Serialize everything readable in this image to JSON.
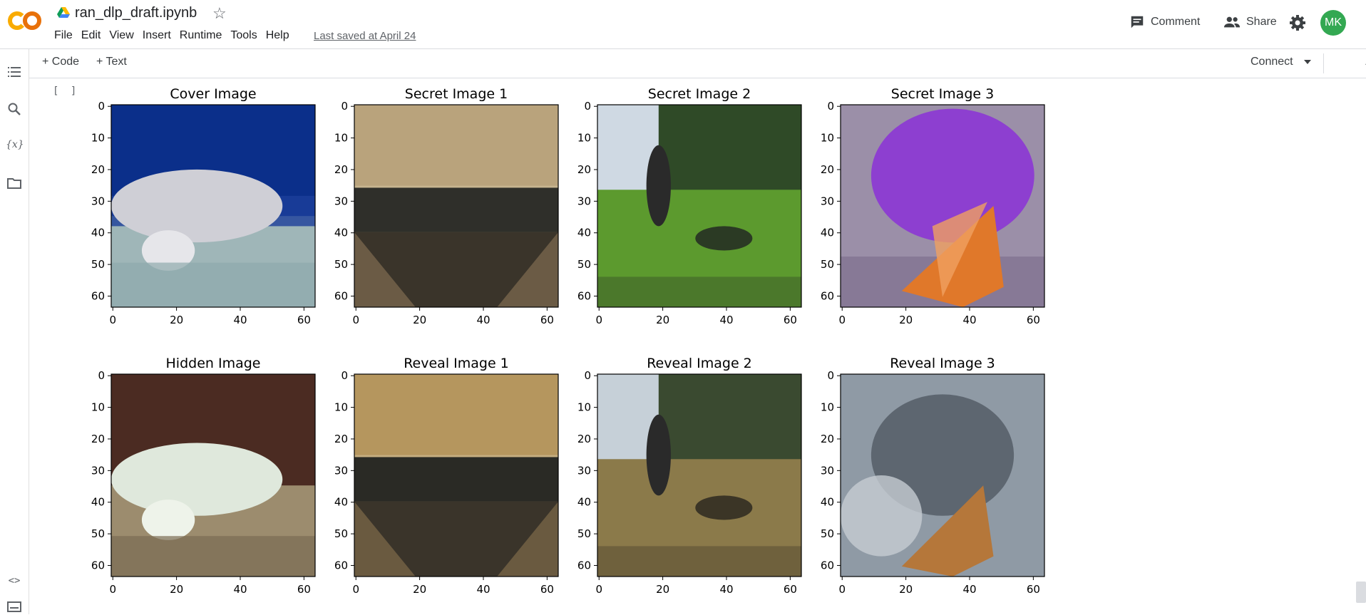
{
  "app": {
    "filename": "ran_dlp_draft.ipynb",
    "logo_text": "CO",
    "menu": [
      "File",
      "Edit",
      "View",
      "Insert",
      "Runtime",
      "Tools",
      "Help"
    ],
    "last_saved": "Last saved at April 24"
  },
  "header": {
    "comment_label": "Comment",
    "share_label": "Share",
    "avatar_initials": "MK",
    "avatar_color": "#33a852"
  },
  "toolbar": {
    "code_label": "+ Code",
    "text_label": "+ Text",
    "connect_label": "Connect"
  },
  "rail_icons": [
    "table-of-contents-icon",
    "search-icon",
    "variables-icon",
    "files-icon",
    "code-snippets-icon",
    "terminal-icon"
  ],
  "cell": {
    "bracket": "[ ]"
  },
  "chart_data": [
    {
      "type": "image",
      "title": "Cover Image",
      "xticks": [
        "0",
        "20",
        "40",
        "60"
      ],
      "yticks": [
        "0",
        "10",
        "20",
        "30",
        "40",
        "50",
        "60"
      ],
      "colors": {
        "top": "#0b2f8a",
        "mid": "#1b3e9a",
        "subject": "#cfcfd6",
        "floor": "#9fb6b8"
      }
    },
    {
      "type": "image",
      "title": "Secret Image 1",
      "xticks": [
        "0",
        "20",
        "40",
        "60"
      ],
      "yticks": [
        "0",
        "10",
        "20",
        "30",
        "40",
        "50",
        "60"
      ],
      "colors": {
        "top": "#b9a37c",
        "band": "#2f2f2a",
        "bottom": "#6b5b45"
      }
    },
    {
      "type": "image",
      "title": "Secret Image 2",
      "xticks": [
        "0",
        "20",
        "40",
        "60"
      ],
      "yticks": [
        "0",
        "10",
        "20",
        "30",
        "40",
        "50",
        "60"
      ],
      "colors": {
        "sky": "#cfd9e3",
        "trees": "#2f4a27",
        "grass": "#5c9a2e",
        "shadow": "#2b3a24"
      }
    },
    {
      "type": "image",
      "title": "Secret Image 3",
      "xticks": [
        "0",
        "20",
        "40",
        "60"
      ],
      "yticks": [
        "0",
        "10",
        "20",
        "30",
        "40",
        "50",
        "60"
      ],
      "colors": {
        "flower": "#8d3fd0",
        "bg": "#9b8fa8",
        "wing": "#e0782a"
      }
    },
    {
      "type": "image",
      "title": "Hidden Image",
      "xticks": [
        "0",
        "20",
        "40",
        "60"
      ],
      "yticks": [
        "0",
        "10",
        "20",
        "30",
        "40",
        "50",
        "60"
      ],
      "colors": {
        "top": "#4b2b22",
        "subject": "#dfe8dc",
        "floor": "#9c8c6e"
      }
    },
    {
      "type": "image",
      "title": "Reveal Image 1",
      "xticks": [
        "0",
        "20",
        "40",
        "60"
      ],
      "yticks": [
        "0",
        "10",
        "20",
        "30",
        "40",
        "50",
        "60"
      ],
      "colors": {
        "top": "#b5965e",
        "band": "#2a2a25",
        "bottom": "#6a5a40"
      }
    },
    {
      "type": "image",
      "title": "Reveal Image 2",
      "xticks": [
        "0",
        "20",
        "40",
        "60"
      ],
      "yticks": [
        "0",
        "10",
        "20",
        "30",
        "40",
        "50",
        "60"
      ],
      "colors": {
        "sky": "#c6d0d8",
        "trees": "#3a4a30",
        "grass": "#8b7a4a",
        "shadow": "#3b3526"
      }
    },
    {
      "type": "image",
      "title": "Reveal Image 3",
      "xticks": [
        "0",
        "20",
        "40",
        "60"
      ],
      "yticks": [
        "0",
        "10",
        "20",
        "30",
        "40",
        "50",
        "60"
      ],
      "colors": {
        "bg": "#8f9aa5",
        "center": "#5d6670",
        "wing": "#b5773a"
      }
    }
  ]
}
